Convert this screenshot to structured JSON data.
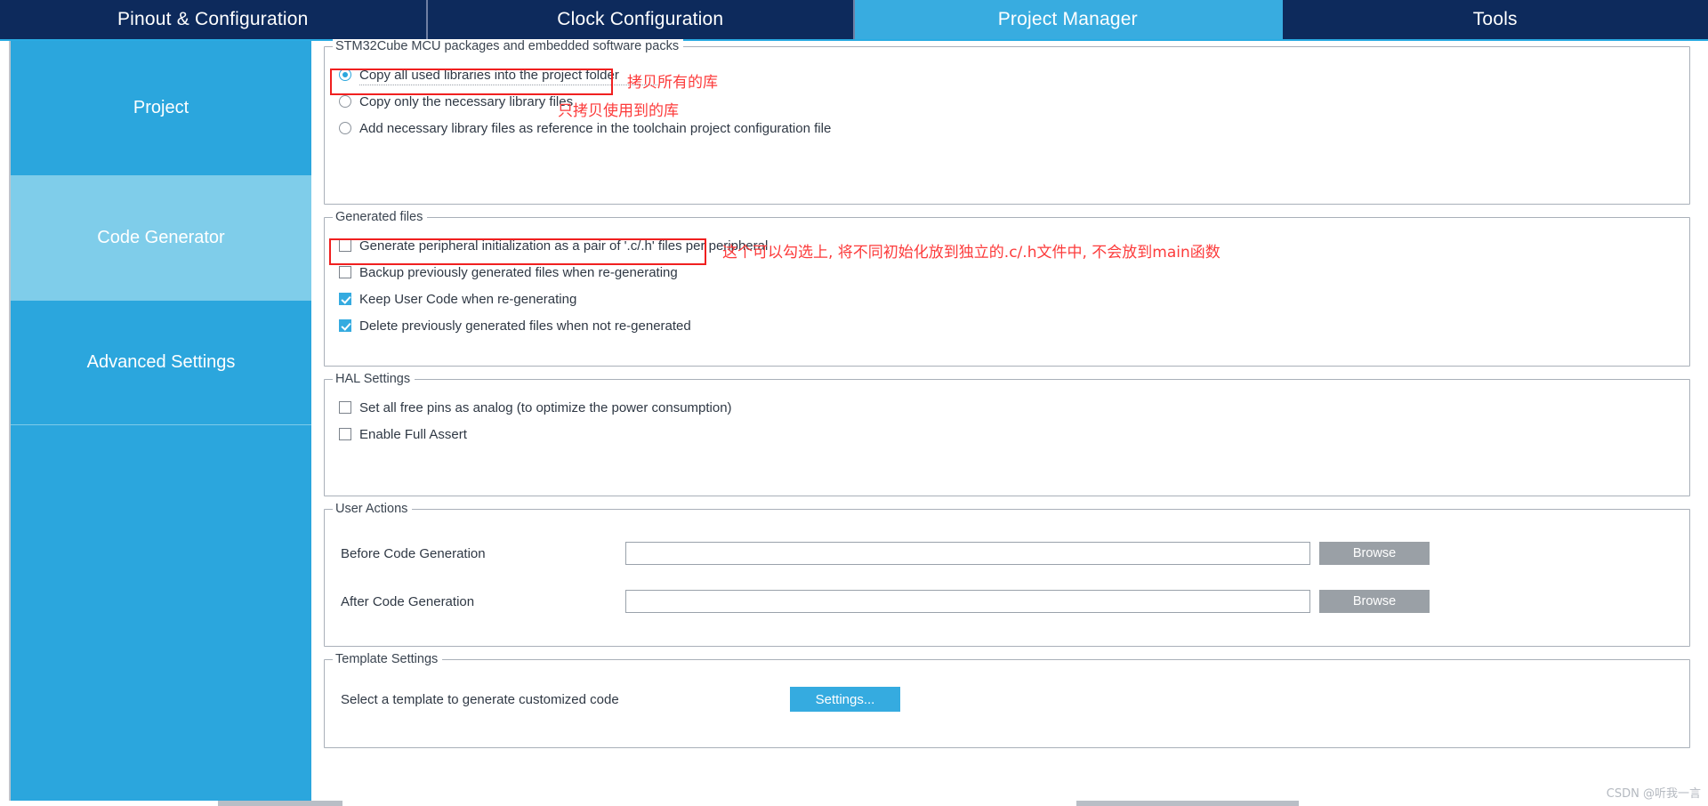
{
  "tabs": [
    {
      "label": "Pinout & Configuration",
      "active": false
    },
    {
      "label": "Clock Configuration",
      "active": false
    },
    {
      "label": "Project Manager",
      "active": true
    },
    {
      "label": "Tools",
      "active": false
    }
  ],
  "sidebar": {
    "items": [
      {
        "label": "Project",
        "selected": false
      },
      {
        "label": "Code Generator",
        "selected": true
      },
      {
        "label": "Advanced Settings",
        "selected": false
      }
    ]
  },
  "groups": {
    "packages": {
      "title": "STM32Cube MCU packages and embedded software packs",
      "options": [
        {
          "label": "Copy all used libraries into the project folder",
          "checked": true
        },
        {
          "label": "Copy only the necessary library files",
          "checked": false
        },
        {
          "label": "Add necessary library files as reference in the toolchain project configuration file",
          "checked": false
        }
      ]
    },
    "generated": {
      "title": "Generated files",
      "options": [
        {
          "label": "Generate peripheral initialization as a pair of '.c/.h' files per peripheral",
          "checked": false
        },
        {
          "label": "Backup previously generated files when re-generating",
          "checked": false
        },
        {
          "label": "Keep User Code when re-generating",
          "checked": true
        },
        {
          "label": "Delete previously generated files when not re-generated",
          "checked": true
        }
      ]
    },
    "hal": {
      "title": "HAL Settings",
      "options": [
        {
          "label": "Set all free pins as analog (to optimize the power consumption)",
          "checked": false
        },
        {
          "label": "Enable Full Assert",
          "checked": false
        }
      ]
    },
    "user_actions": {
      "title": "User Actions",
      "rows": [
        {
          "label": "Before Code Generation",
          "value": "",
          "placeholder": "",
          "button": "Browse"
        },
        {
          "label": "After Code Generation",
          "value": "",
          "placeholder": "",
          "button": "Browse"
        }
      ]
    },
    "template": {
      "title": "Template Settings",
      "label": "Select a template to generate customized code",
      "button": "Settings..."
    }
  },
  "annotations": [
    {
      "text": "拷贝所有的库"
    },
    {
      "text": "只拷贝使用到的库"
    },
    {
      "text": "这个可以勾选上, 将不同初始化放到独立的.c/.h文件中,  不会放到main函数"
    }
  ],
  "watermark": "CSDN @听我一言",
  "colors": {
    "tab_active": "#38ace0",
    "tab_inactive": "#0d2a5c",
    "sidebar": "#2ba6dd",
    "sidebar_selected": "#7fcdea",
    "accent": "#35abe0",
    "annotation_red": "#fc3b3b",
    "browse_button": "#9aa0a6"
  }
}
